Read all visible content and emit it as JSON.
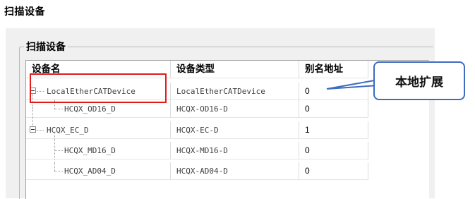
{
  "window": {
    "title": "扫描设备"
  },
  "group": {
    "label": "扫描设备"
  },
  "table": {
    "headers": {
      "name": "设备名",
      "type": "设备类型",
      "alias": "别名地址"
    },
    "rows": [
      {
        "name": "LocalEtherCATDevice",
        "type": "LocalEtherCATDevice",
        "alias": "0"
      },
      {
        "name": "HCQX_OD16_D",
        "type": "HCQX-OD16-D",
        "alias": "0"
      },
      {
        "name": "HCQX_EC_D",
        "type": "HCQX-EC-D",
        "alias": "1"
      },
      {
        "name": "HCQX_MD16_D",
        "type": "HCQX-MD16-D",
        "alias": "0"
      },
      {
        "name": "HCQX_AD04_D",
        "type": "HCQX-AD04-D",
        "alias": "0"
      }
    ]
  },
  "annotation": {
    "callout_text": "本地扩展",
    "highlight_color": "#e21b1b",
    "callout_border_color": "#3d6cc1"
  },
  "icons": {
    "collapse": "tree-collapse-icon"
  }
}
